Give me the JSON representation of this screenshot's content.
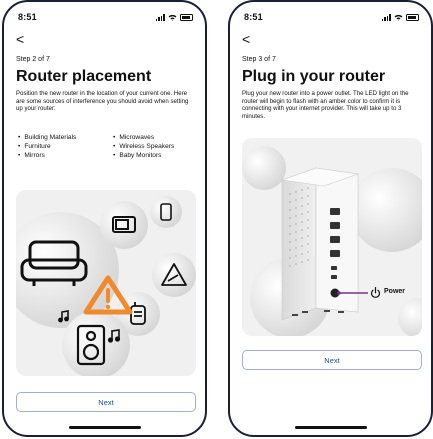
{
  "screens": [
    {
      "status_time": "8:51",
      "back_label": "<",
      "step": "Step 2 of 7",
      "title": "Router placement",
      "description": "Position the new router in the location of your current one. Here are some sources of interference you should avoid when setting up your router:",
      "bullets_left": [
        "Building Materials",
        "Furniture",
        "Mirrors"
      ],
      "bullets_right": [
        "Microwaves",
        "Wireless Speakers",
        "Baby Monitors"
      ],
      "next_label": "Next"
    },
    {
      "status_time": "8:51",
      "back_label": "<",
      "step": "Step 3 of 7",
      "title": "Plug in your router",
      "description": "Plug your new router into a power outlet. The LED light on the router will begin to flash with an amber color to confirm it is connecting with your internet provider. This will take up to 3 minutes.",
      "power_label": "Power",
      "next_label": "Next"
    }
  ],
  "colors": {
    "frame": "#1a1f36",
    "button_text": "#1f4e8c",
    "button_border": "#9fb2cc",
    "warning": "#f08a2c",
    "power_line": "#7b2d8e"
  }
}
